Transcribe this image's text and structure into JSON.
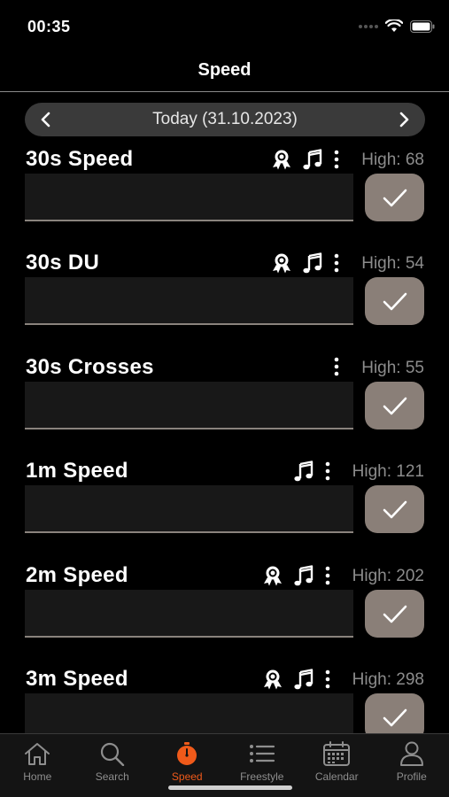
{
  "status": {
    "time": "00:35"
  },
  "nav": {
    "title": "Speed"
  },
  "date_bar": {
    "label": "Today (31.10.2023)"
  },
  "entries": [
    {
      "title": "30s Speed",
      "high": "High: 68",
      "icons": [
        "award-icon",
        "music-icon",
        "more-icon"
      ]
    },
    {
      "title": "30s DU",
      "high": "High: 54",
      "icons": [
        "award-icon",
        "music-icon",
        "more-icon"
      ]
    },
    {
      "title": "30s Crosses",
      "high": "High: 55",
      "icons": [
        "more-icon"
      ]
    },
    {
      "title": "1m Speed",
      "high": "High: 121",
      "icons": [
        "music-icon",
        "more-icon"
      ]
    },
    {
      "title": "2m Speed",
      "high": "High: 202",
      "icons": [
        "award-icon",
        "music-icon",
        "more-icon"
      ]
    },
    {
      "title": "3m Speed",
      "high": "High: 298",
      "icons": [
        "award-icon",
        "music-icon",
        "more-icon"
      ]
    }
  ],
  "tabs": [
    {
      "label": "Home",
      "icon": "home-icon",
      "active": false
    },
    {
      "label": "Search",
      "icon": "search-icon",
      "active": false
    },
    {
      "label": "Speed",
      "icon": "stopwatch-icon",
      "active": true
    },
    {
      "label": "Freestyle",
      "icon": "list-icon",
      "active": false
    },
    {
      "label": "Calendar",
      "icon": "calendar-icon",
      "active": false
    },
    {
      "label": "Profile",
      "icon": "profile-icon",
      "active": false
    }
  ],
  "colors": {
    "background": "#000000",
    "accent": "#f05a1a",
    "check_button": "#8a7f78",
    "date_bar": "#3a3a3a",
    "input": "#181818",
    "muted_text": "#8c8c8c"
  }
}
